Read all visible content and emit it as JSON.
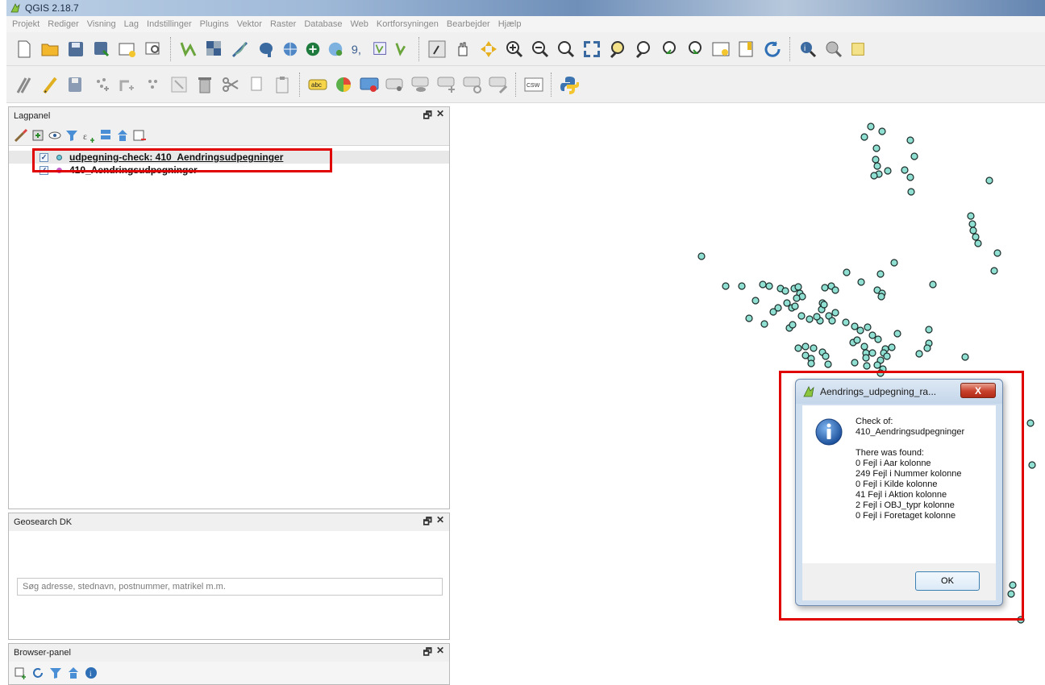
{
  "window": {
    "title": "QGIS 2.18.7"
  },
  "menubar": [
    "Projekt",
    "Rediger",
    "Visning",
    "Lag",
    "Indstillinger",
    "Plugins",
    "Vektor",
    "Raster",
    "Database",
    "Web",
    "Kortforsyningen",
    "Bearbejder",
    "Hjælp"
  ],
  "toolbar2": {
    "csw_label": "CSW",
    "abc_label": "abc"
  },
  "lagpanel": {
    "title": "Lagpanel",
    "layers": [
      {
        "name": "udpegning-check: 410_Aendringsudpegninger",
        "checked": true,
        "color": "#6fc8d8"
      },
      {
        "name": "410_Aendringsudpegninger",
        "checked": true,
        "color": "#c15bc9"
      }
    ]
  },
  "geosearch": {
    "title": "Geosearch DK",
    "placeholder": "Søg adresse, stednavn, postnummer, matrikel m.m."
  },
  "browser": {
    "title": "Browser-panel"
  },
  "panel_buttons": {
    "float": "🗗",
    "close": "✕"
  },
  "map": {
    "point_fill": "#8fe0d2",
    "point_stroke": "#1b2b28"
  },
  "dialog": {
    "title": "Aendrings_udpegning_ra...",
    "close_label": "X",
    "lines_a": [
      "Check of:",
      "410_Aendringsudpegninger"
    ],
    "lines_b": [
      "There was found:",
      "0 Fejl i Aar kolonne",
      "249 Fejl i Nummer kolonne",
      "0 Fejl i Kilde kolonne",
      "41 Fejl i Aktion kolonne",
      "2 Fejl i OBJ_typr kolonne",
      "0 Fejl i Foretaget kolonne"
    ],
    "ok_label": "OK"
  }
}
